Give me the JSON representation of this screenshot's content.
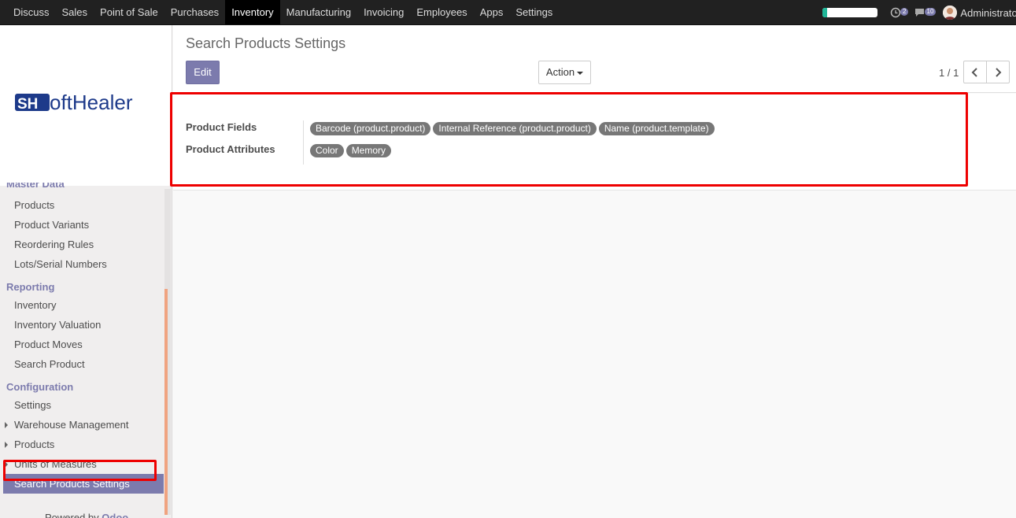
{
  "navbar": {
    "menus": [
      "Discuss",
      "Sales",
      "Point of Sale",
      "Purchases",
      "Inventory",
      "Manufacturing",
      "Invoicing",
      "Employees",
      "Apps",
      "Settings"
    ],
    "active_menu": "Inventory",
    "progress_fraction": 0.08,
    "activity_count": "2",
    "messages_count": "10",
    "user_name": "Administrator"
  },
  "sidebar": {
    "logo_text": "SoftHealer",
    "master_data_heading": "Master Data",
    "master_data_items": [
      "Products",
      "Product Variants",
      "Reordering Rules",
      "Lots/Serial Numbers"
    ],
    "reporting_heading": "Reporting",
    "reporting_items": [
      "Inventory",
      "Inventory Valuation",
      "Product Moves",
      "Search Product"
    ],
    "configuration_heading": "Configuration",
    "config_settings": "Settings",
    "config_warehouse": "Warehouse Management",
    "config_products": "Products",
    "config_uom": "Units of Measures",
    "config_search_settings": "Search Products Settings",
    "powered_prefix": "Powered by ",
    "powered_brand": "Odoo"
  },
  "control_panel": {
    "title": "Search Products Settings",
    "edit_label": "Edit",
    "action_label": "Action",
    "pager": "1 / 1"
  },
  "form": {
    "product_fields_label": "Product Fields",
    "product_fields_tags": [
      "Barcode (product.product)",
      "Internal Reference (product.product)",
      "Name (product.template)"
    ],
    "product_attributes_label": "Product Attributes",
    "product_attributes_tags": [
      "Color",
      "Memory"
    ]
  },
  "colors": {
    "brand": "#7c7bad",
    "highlight": "#ee0000",
    "tag": "#777777"
  }
}
